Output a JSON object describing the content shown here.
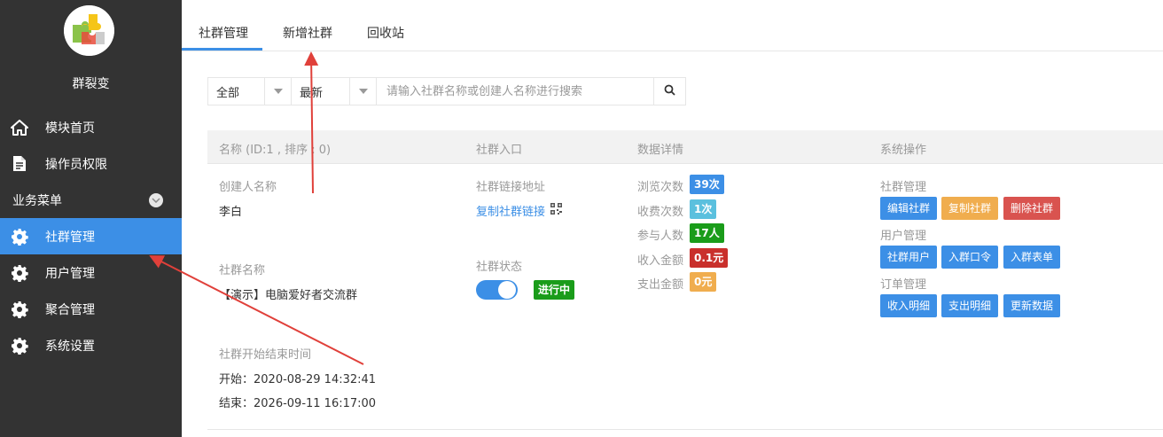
{
  "app": {
    "name": "群裂变"
  },
  "sidebar": {
    "items": [
      {
        "label": "模块首页",
        "icon": "home-icon"
      },
      {
        "label": "操作员权限",
        "icon": "document-icon"
      }
    ],
    "section": {
      "label": "业务菜单"
    },
    "menu": [
      {
        "label": "社群管理",
        "icon": "gear-icon",
        "active": true
      },
      {
        "label": "用户管理",
        "icon": "gear-icon"
      },
      {
        "label": "聚合管理",
        "icon": "gear-icon"
      },
      {
        "label": "系统设置",
        "icon": "gear-icon"
      }
    ]
  },
  "tabs": [
    "社群管理",
    "新增社群",
    "回收站"
  ],
  "search": {
    "filter1": "全部",
    "filter2": "最新",
    "placeholder": "请输入社群名称或创建人名称进行搜索"
  },
  "table": {
    "headers": [
      "名称 (ID:1 , 排序 : 0)",
      "社群入口",
      "数据详情",
      "系统操作"
    ],
    "row": {
      "creator_label": "创建人名称",
      "creator": "李白",
      "group_name_label": "社群名称",
      "group_name": "【演示】电脑爱好者交流群",
      "time_label": "社群开始结束时间",
      "start": "开始：2020-08-29 14:32:41",
      "end": "结束：2026-09-11 16:17:00",
      "link_label": "社群链接地址",
      "copy_link": "复制社群链接",
      "status_label": "社群状态",
      "status_badge": "进行中",
      "stats": [
        {
          "label": "浏览次数",
          "value": "39次"
        },
        {
          "label": "收费次数",
          "value": "1次"
        },
        {
          "label": "参与人数",
          "value": "17人"
        },
        {
          "label": "收入金额",
          "value": "0.1元"
        },
        {
          "label": "支出金额",
          "value": "0元"
        }
      ],
      "ops": {
        "group_title": "社群管理",
        "group_buttons": [
          "编辑社群",
          "复制社群",
          "删除社群"
        ],
        "user_title": "用户管理",
        "user_buttons": [
          "社群用户",
          "入群口令",
          "入群表单"
        ],
        "order_title": "订单管理",
        "order_buttons": [
          "收入明细",
          "支出明细",
          "更新数据"
        ]
      }
    }
  },
  "colors": {
    "sidebar_bg": "#333333",
    "accent": "#3c8fe6",
    "annotation_arrow": "#e0403a"
  }
}
